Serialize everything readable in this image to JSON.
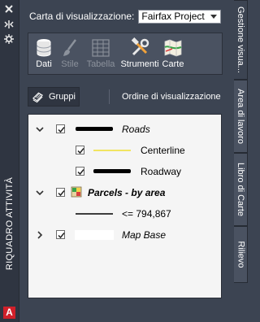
{
  "palette": {
    "title": "RIQUADRO ATTIVITÀ",
    "logo_letter": "A"
  },
  "right_tabs": [
    {
      "label": "Gestione visua..."
    },
    {
      "label": "Area di lavoro"
    },
    {
      "label": "Libro di Carte"
    },
    {
      "label": "Rilievo"
    }
  ],
  "map": {
    "label": "Carta di visualizzazione:",
    "selected": "Fairfax Project"
  },
  "toolbar": {
    "dati": "Dati",
    "stile": "Stile",
    "tabella": "Tabella",
    "strumenti": "Strumenti",
    "carte": "Carte"
  },
  "subtoolbar": {
    "gruppi": "Gruppi",
    "ordine": "Ordine di visualizzazione"
  },
  "tree": {
    "roads": "Roads",
    "centerline": "Centerline",
    "roadway": "Roadway",
    "parcels": "Parcels - by area",
    "parcel_range": "<= 794,867",
    "mapbase": "Map Base"
  }
}
